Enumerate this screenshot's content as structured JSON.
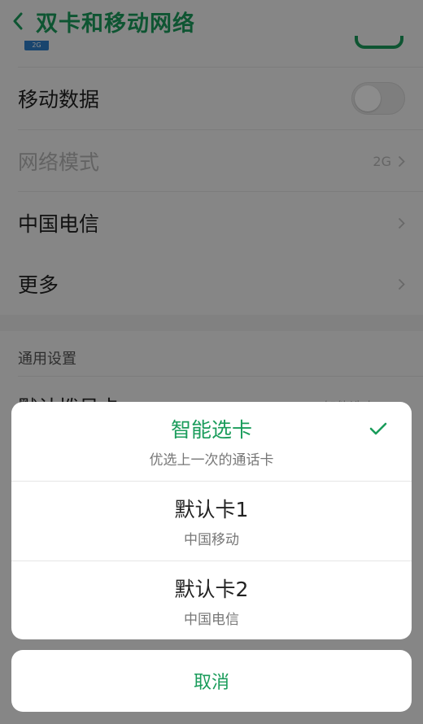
{
  "header": {
    "title": "双卡和移动网络"
  },
  "settings": {
    "sim_badge": "2G",
    "mobile_data_label": "移动数据",
    "network_mode_label": "网络模式",
    "network_mode_value": "2G",
    "carrier_label": "中国电信",
    "more_label": "更多",
    "general_section_title": "通用设置",
    "default_dial_label": "默认拨号卡",
    "default_dial_value": "智能选卡"
  },
  "sheet": {
    "options": [
      {
        "title": "智能选卡",
        "subtitle": "优选上一次的通话卡",
        "selected": true
      },
      {
        "title": "默认卡1",
        "subtitle": "中国移动",
        "selected": false
      },
      {
        "title": "默认卡2",
        "subtitle": "中国电信",
        "selected": false
      }
    ],
    "cancel_label": "取消"
  },
  "colors": {
    "accent": "#1a9c5b",
    "overlay": "rgba(0,0,0,0.45)"
  },
  "icons": {
    "back": "chevron-left-icon",
    "chevron": "chevron-right-icon",
    "check": "check-icon"
  }
}
